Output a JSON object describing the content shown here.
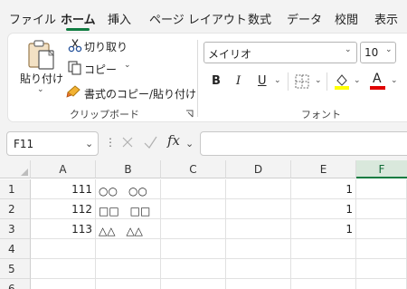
{
  "tabs": [
    "ファイル",
    "ホーム",
    "挿入",
    "ページ レイアウト",
    "数式",
    "データ",
    "校閲",
    "表示"
  ],
  "active_tab": "ホーム",
  "accent_color": "#107c41",
  "clipboard": {
    "paste_label": "貼り付け",
    "cut_label": "切り取り",
    "copy_label": "コピー",
    "format_painter_label": "書式のコピー/貼り付け",
    "group_label": "クリップボード"
  },
  "font": {
    "font_name": "メイリオ",
    "font_size": "10",
    "bold": "B",
    "italic": "I",
    "underline": "U",
    "font_color_letter": "A",
    "group_label": "フォント",
    "fill_color": "#ffff00",
    "text_color": "#e00000"
  },
  "formula_bar": {
    "name_box": "F11",
    "fx_label": "fx",
    "formula": ""
  },
  "sheet": {
    "columns": [
      "A",
      "B",
      "C",
      "D",
      "E",
      "F"
    ],
    "selected_column": "F",
    "rows": [
      {
        "num": "1",
        "A": "111",
        "B": "○○　○○",
        "E": "1"
      },
      {
        "num": "2",
        "A": "112",
        "B": "□□　□□",
        "E": "1"
      },
      {
        "num": "3",
        "A": "113",
        "B": "△△　△△",
        "E": "1"
      },
      {
        "num": "4",
        "A": "",
        "B": "",
        "E": ""
      },
      {
        "num": "5",
        "A": "",
        "B": "",
        "E": ""
      },
      {
        "num": "6",
        "A": "",
        "B": "",
        "E": ""
      }
    ]
  }
}
